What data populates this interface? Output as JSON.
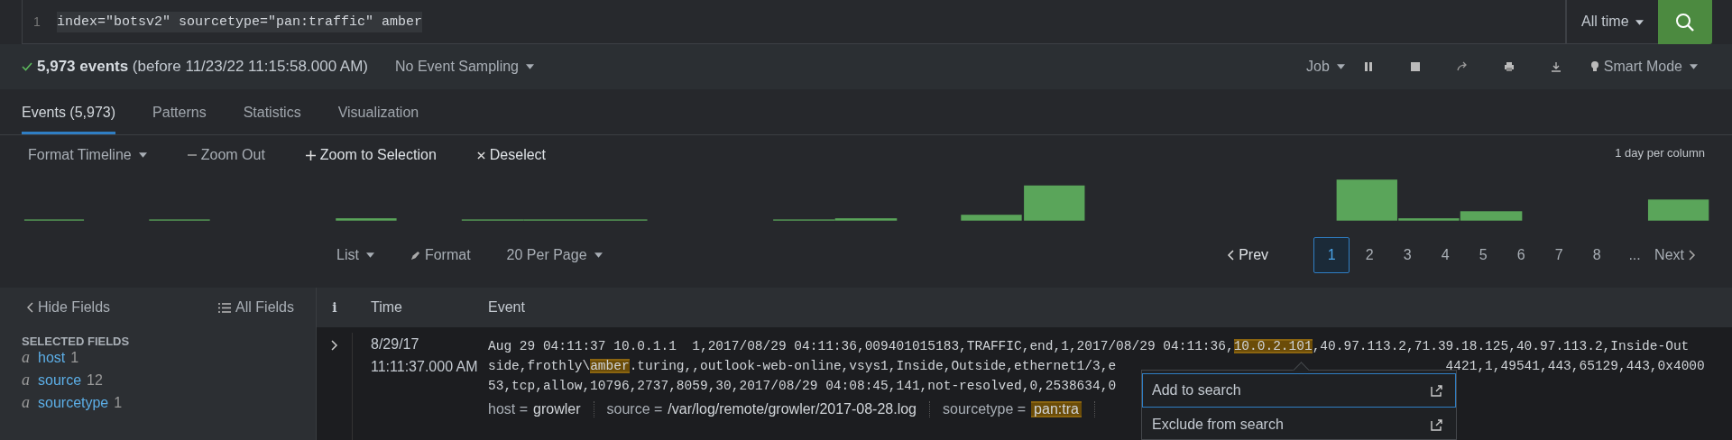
{
  "search": {
    "line_number": "1",
    "query": "index=\"botsv2\" sourcetype=\"pan:traffic\" amber",
    "time_range": "All time"
  },
  "status": {
    "count": "5,973 events",
    "detail": "(before 11/23/22 11:15:58.000 AM)",
    "sampling": "No Event Sampling",
    "job": "Job",
    "mode": "Smart Mode"
  },
  "tabs": [
    {
      "label": "Events (5,973)",
      "selected": true
    },
    {
      "label": "Patterns",
      "selected": false
    },
    {
      "label": "Statistics",
      "selected": false
    },
    {
      "label": "Visualization",
      "selected": false
    }
  ],
  "timeline": {
    "format": "Format Timeline",
    "zoom_out": "Zoom Out",
    "zoom_selection": "Zoom to Selection",
    "deselect": "Deselect",
    "scale": "1 day per column"
  },
  "results": {
    "list": "List",
    "format": "Format",
    "per_page": "20 Per Page",
    "prev": "Prev",
    "next": "Next",
    "pages": [
      {
        "label": "1",
        "selected": true
      },
      {
        "label": "2",
        "selected": false
      },
      {
        "label": "3",
        "selected": false
      },
      {
        "label": "4",
        "selected": false
      },
      {
        "label": "5",
        "selected": false
      },
      {
        "label": "6",
        "selected": false
      },
      {
        "label": "7",
        "selected": false
      },
      {
        "label": "8",
        "selected": false
      },
      {
        "label": "...",
        "selected": false
      }
    ]
  },
  "fields": {
    "hide": "Hide Fields",
    "all": "All Fields",
    "section": "SELECTED FIELDS",
    "items": [
      {
        "type": "a",
        "name": "host",
        "count": "1"
      },
      {
        "type": "a",
        "name": "source",
        "count": "12"
      },
      {
        "type": "a",
        "name": "sourcetype",
        "count": "1"
      }
    ]
  },
  "table": {
    "columns": [
      "i",
      "Time",
      "Event"
    ],
    "rows": [
      {
        "expanded": false,
        "time": [
          "8/29/17",
          "11:11:37.000 AM"
        ],
        "lines": [
          {
            "segments": [
              {
                "text": "Aug 29 04:11:37 10.0.1.1  1,2017/08/29 04:11:36,009401015183,TRAFFIC,end,1,2017/08/29 04:11:36,",
                "match": false
              },
              {
                "text": "10.0.2.101",
                "match": true
              },
              {
                "text": ",40.97.113.2,71.39.18.125,40.97.113.2,Inside-Out",
                "match": false
              }
            ]
          },
          {
            "segments": [
              {
                "text": "side,frothly\\",
                "match": false
              },
              {
                "text": "amber",
                "match": true
              },
              {
                "text": ".turing,,outlook-web-online,vsys1,Inside,Outside,ethernet1/3,e",
                "match": false
              }
            ],
            "after_menu": "4421,1,49541,443,65129,443,0x4000"
          },
          {
            "segments": [
              {
                "text": "53,tcp,allow,10796,2737,8059,30,2017/08/29 04:08:45,141,not-resolved,0,2538634,0",
                "match": false
              }
            ]
          }
        ],
        "fields": [
          {
            "key": "host =",
            "value": "growler",
            "match": false
          },
          {
            "key": "source =",
            "value": "/var/log/remote/growler/2017-08-28.log",
            "match": false
          },
          {
            "key": "sourcetype =",
            "value": "pan:tra",
            "match": true
          }
        ]
      }
    ]
  },
  "context_menu": {
    "items": [
      {
        "label": "Add to search",
        "selected": true
      },
      {
        "label": "Exclude from search",
        "selected": false
      }
    ]
  }
}
